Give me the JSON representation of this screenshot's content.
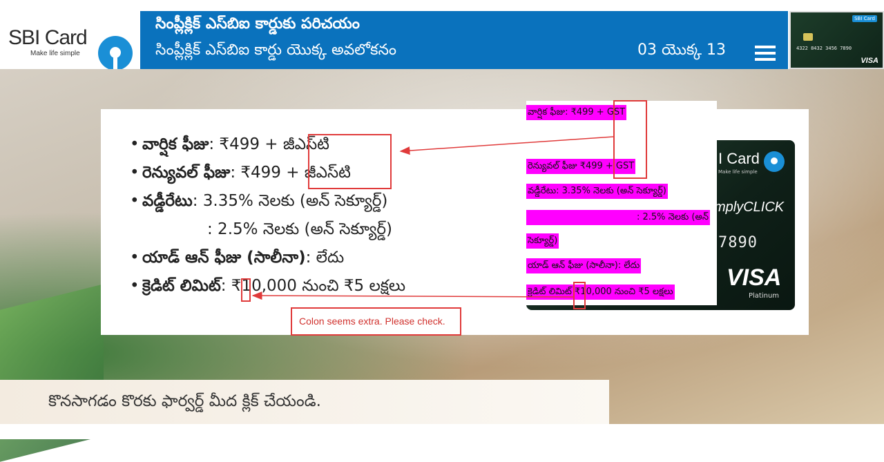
{
  "header": {
    "logo_text": "SBI Card",
    "logo_tagline": "Make life simple",
    "title_line1": "సింప్లీక్లిక్ ఎస్‌బిఐ కార్డుకు పరిచయం",
    "title_line2": "సింప్లీక్లిక్ ఎస్‌బిఐ కార్డు యొక్క అవలోకనం",
    "page_counter": "03 యొక్క 13",
    "thumb_brand": "SBI Card",
    "thumb_number": "4322 8432 3456 7890",
    "thumb_visa": "VISA"
  },
  "bullets": [
    {
      "label": "వార్షిక ఫీజు",
      "value": ": ₹499 + జీఎస్‌టి"
    },
    {
      "label": "రెన్యువల్ ఫీజు",
      "value": ": ₹499 + జీఎస్‌టి"
    },
    {
      "label": "వడ్డీరేటు",
      "value": ": 3.35% నెలకు (అన్ సెక్యూర్డ్)"
    },
    {
      "label": "",
      "value": ": 2.5% నెలకు (అన్ సెక్యూర్డ్)"
    },
    {
      "label": "యాడ్ ఆన్ ఫీజు (సాలీనా)",
      "value": ": లేదు"
    },
    {
      "label": "క్రెడిట్ లిమిట్",
      "value": ": ₹10,000 నుంచి ₹5 లక్షలు"
    }
  ],
  "card": {
    "brand": "I Card",
    "brand_sub": "Make life simple",
    "product": "mplyCLICK",
    "number": "7890",
    "visa": "VISA",
    "tier": "Platinum"
  },
  "overlay_lines": [
    "వార్షిక ఫీజు: ₹499 + GST",
    "రెన్యువల్ ఫీజు ₹499 + GST",
    "వడ్డీరేటు: 3.35% నెలకు (అన్ సెక్యూర్డ్)",
    ": 2.5% నెలకు (అన్",
    "సెక్యూర్డ్)",
    "యాడ్ ఆన్ ఫీజు (సాలీనా): లేదు",
    "క్రెడిట్ లిమిట్ ₹10,000 నుంచి ₹5 లక్షలు"
  ],
  "review_note": "Colon seems extra. Please check.",
  "footer": {
    "instruction": "కొనసాగడం కొరకు ఫార్వర్డ్ మీద క్లిక్ చేయండి."
  },
  "colors": {
    "header_blue": "#0a72bd",
    "highlight_magenta": "#ff00ff",
    "annotation_red": "#e03a3a"
  }
}
